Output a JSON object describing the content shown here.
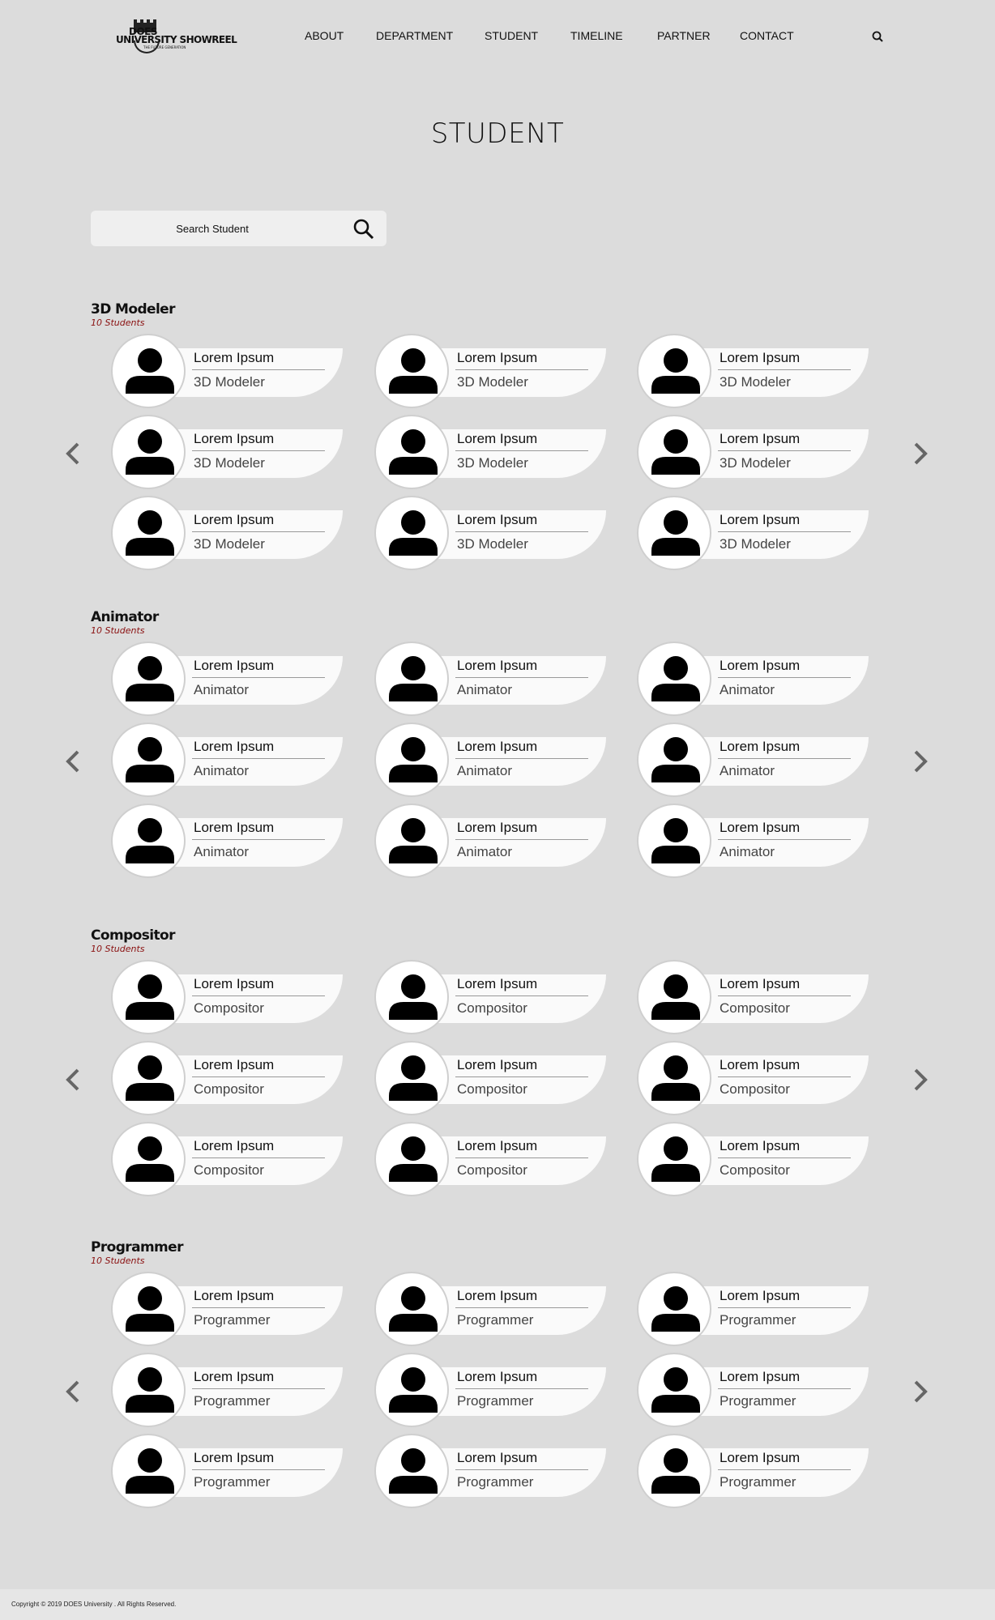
{
  "logo": {
    "line1": "DOES",
    "line2": "UNIVERSITY SHOWREEL",
    "tagline": "THE FUTURE GENERATION"
  },
  "nav": {
    "items": [
      "ABOUT",
      "DEPARTMENT",
      "STUDENT",
      "TIMELINE",
      "PARTNER",
      "CONTACT"
    ],
    "search_icon": "search-icon"
  },
  "page": {
    "title": "STUDENT"
  },
  "search": {
    "placeholder": "Search Student",
    "value": ""
  },
  "sections": [
    {
      "title": "3D Modeler",
      "count": "10 Students",
      "cards": [
        {
          "name": "Lorem Ipsum",
          "role": "3D Modeler"
        },
        {
          "name": "Lorem Ipsum",
          "role": "3D Modeler"
        },
        {
          "name": "Lorem Ipsum",
          "role": "3D Modeler"
        },
        {
          "name": "Lorem Ipsum",
          "role": "3D Modeler"
        },
        {
          "name": "Lorem Ipsum",
          "role": "3D Modeler"
        },
        {
          "name": "Lorem Ipsum",
          "role": "3D Modeler"
        },
        {
          "name": "Lorem Ipsum",
          "role": "3D Modeler"
        },
        {
          "name": "Lorem Ipsum",
          "role": "3D Modeler"
        },
        {
          "name": "Lorem Ipsum",
          "role": "3D Modeler"
        }
      ]
    },
    {
      "title": "Animator",
      "count": "10 Students",
      "cards": [
        {
          "name": "Lorem Ipsum",
          "role": "Animator"
        },
        {
          "name": "Lorem Ipsum",
          "role": "Animator"
        },
        {
          "name": "Lorem Ipsum",
          "role": "Animator"
        },
        {
          "name": "Lorem Ipsum",
          "role": "Animator"
        },
        {
          "name": "Lorem Ipsum",
          "role": "Animator"
        },
        {
          "name": "Lorem Ipsum",
          "role": "Animator"
        },
        {
          "name": "Lorem Ipsum",
          "role": "Animator"
        },
        {
          "name": "Lorem Ipsum",
          "role": "Animator"
        },
        {
          "name": "Lorem Ipsum",
          "role": "Animator"
        }
      ]
    },
    {
      "title": "Compositor",
      "count": "10 Students",
      "cards": [
        {
          "name": "Lorem Ipsum",
          "role": "Compositor"
        },
        {
          "name": "Lorem Ipsum",
          "role": "Compositor"
        },
        {
          "name": "Lorem Ipsum",
          "role": "Compositor"
        },
        {
          "name": "Lorem Ipsum",
          "role": "Compositor"
        },
        {
          "name": "Lorem Ipsum",
          "role": "Compositor"
        },
        {
          "name": "Lorem Ipsum",
          "role": "Compositor"
        },
        {
          "name": "Lorem Ipsum",
          "role": "Compositor"
        },
        {
          "name": "Lorem Ipsum",
          "role": "Compositor"
        },
        {
          "name": "Lorem Ipsum",
          "role": "Compositor"
        }
      ]
    },
    {
      "title": "Programmer",
      "count": "10 Students",
      "cards": [
        {
          "name": "Lorem Ipsum",
          "role": "Programmer"
        },
        {
          "name": "Lorem Ipsum",
          "role": "Programmer"
        },
        {
          "name": "Lorem Ipsum",
          "role": "Programmer"
        },
        {
          "name": "Lorem Ipsum",
          "role": "Programmer"
        },
        {
          "name": "Lorem Ipsum",
          "role": "Programmer"
        },
        {
          "name": "Lorem Ipsum",
          "role": "Programmer"
        },
        {
          "name": "Lorem Ipsum",
          "role": "Programmer"
        },
        {
          "name": "Lorem Ipsum",
          "role": "Programmer"
        },
        {
          "name": "Lorem Ipsum",
          "role": "Programmer"
        }
      ]
    }
  ],
  "footer": {
    "copyright": "Copyright © 2019 DOES University . All Rights Reserved."
  },
  "colors": {
    "background": "#dcdcdc",
    "accent_count": "#8a1010",
    "arrow": "#666666"
  }
}
